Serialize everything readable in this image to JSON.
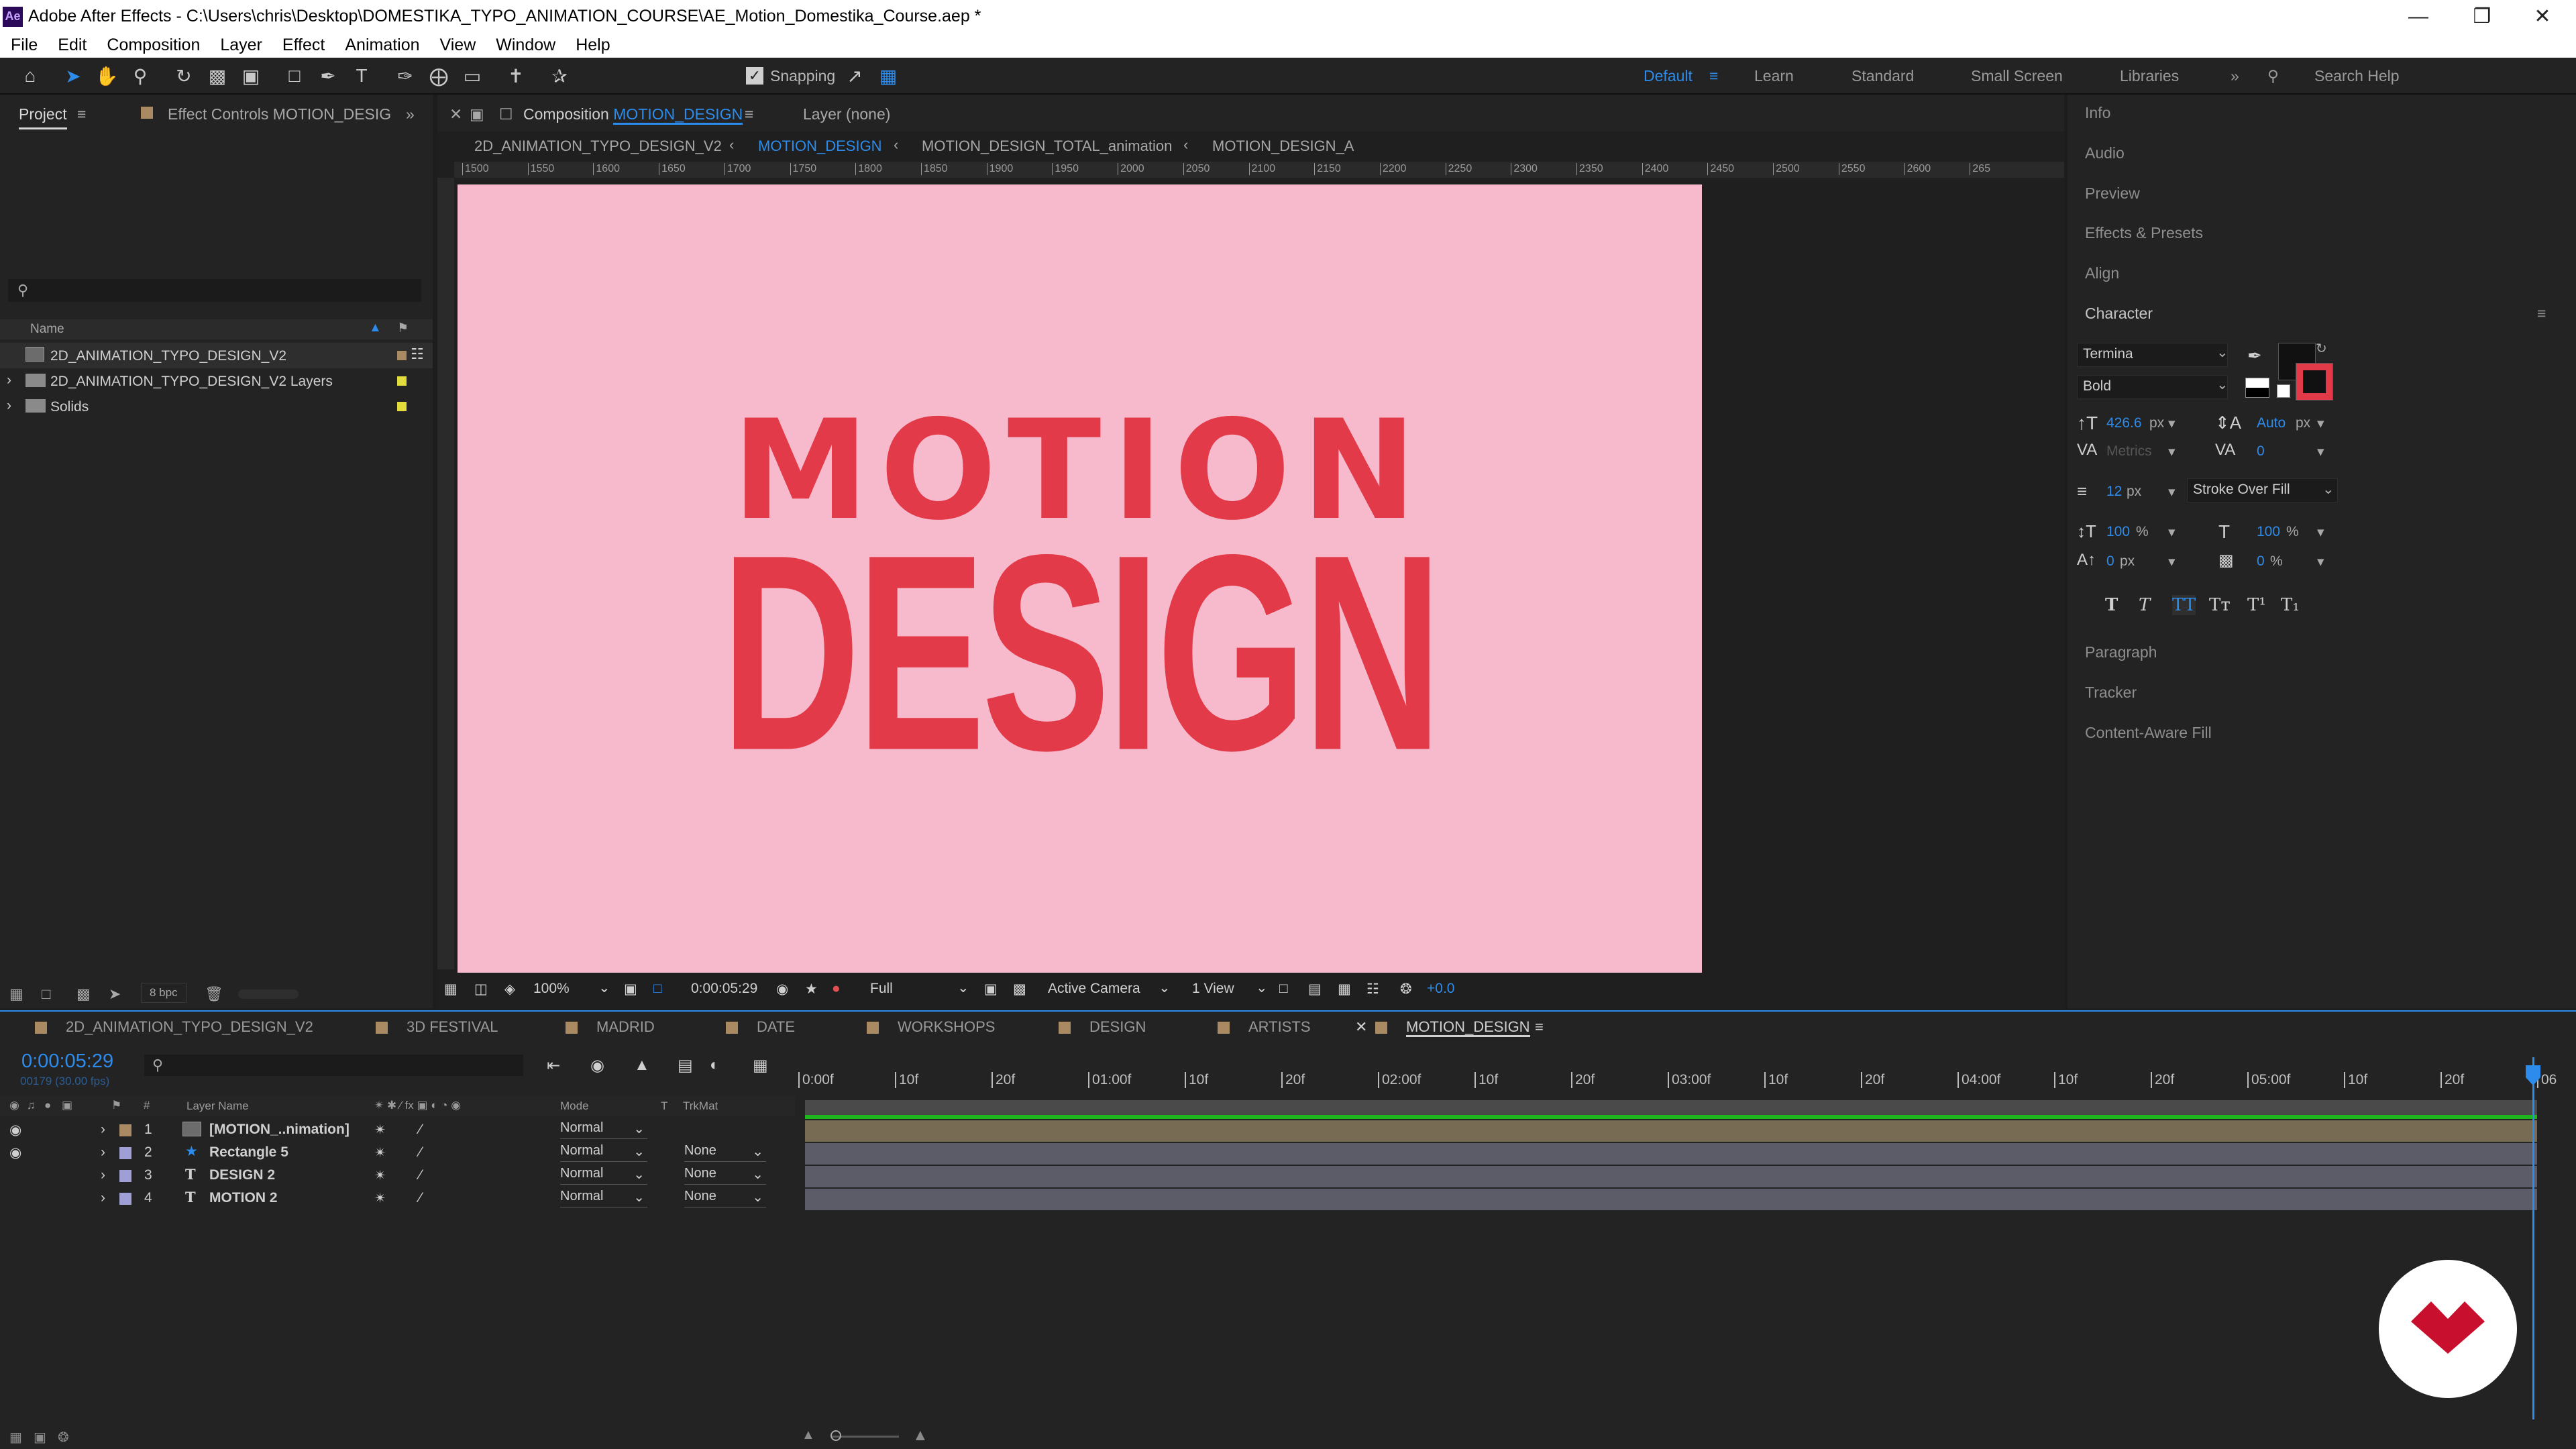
{
  "window": {
    "app": "Adobe After Effects",
    "title": "Adobe After Effects - C:\\Users\\chris\\Desktop\\DOMESTIKA_TYPO_ANIMATION_COURSE\\AE_Motion_Domestika_Course.aep *"
  },
  "menu": [
    "File",
    "Edit",
    "Composition",
    "Layer",
    "Effect",
    "Animation",
    "View",
    "Window",
    "Help"
  ],
  "toolbar": {
    "snapping": "Snapping",
    "workspaces": [
      "Default",
      "Learn",
      "Standard",
      "Small Screen",
      "Libraries"
    ],
    "search_placeholder": "Search Help"
  },
  "project": {
    "tab_project": "Project",
    "tab_effect_controls": "Effect Controls MOTION_DESIG",
    "column_name": "Name",
    "items": [
      {
        "name": "2D_ANIMATION_TYPO_DESIGN_V2",
        "label_color": "#a98a62"
      },
      {
        "name": "2D_ANIMATION_TYPO_DESIGN_V2 Layers",
        "label_color": "#e1dc3c"
      },
      {
        "name": "Solids",
        "label_color": "#e1dc3c"
      }
    ],
    "bpc": "8 bpc"
  },
  "composition": {
    "tab_prefix": "Composition",
    "tab_name": "MOTION_DESIGN",
    "layer_tab": "Layer (none)",
    "breadcrumbs": [
      "2D_ANIMATION_TYPO_DESIGN_V2",
      "MOTION_DESIGN",
      "MOTION_DESIGN_TOTAL_animation",
      "MOTION_DESIGN_A"
    ],
    "ruler_ticks": [
      "1500",
      "1550",
      "1600",
      "1650",
      "1700",
      "1750",
      "1800",
      "1850",
      "1900",
      "1950",
      "2000",
      "2050",
      "2100",
      "2150",
      "2200",
      "2250",
      "2300",
      "2350",
      "2400",
      "2450",
      "2500",
      "2550",
      "2600",
      "265"
    ],
    "canvas_text_line1": "MOTION",
    "canvas_text_line2": "DESIGN",
    "bg_color": "#f7bacd",
    "text_color": "#e23a48",
    "footer": {
      "zoom": "100%",
      "timecode": "0:00:05:29",
      "resolution": "Full",
      "camera": "Active Camera",
      "view": "1 View",
      "exposure": "+0.0"
    }
  },
  "right_panels": {
    "items_top": [
      "Info",
      "Audio",
      "Preview",
      "Effects & Presets",
      "Align"
    ],
    "character": {
      "title": "Character",
      "font": "Termina",
      "style": "Bold",
      "font_size": "426.6",
      "font_size_unit": "px",
      "leading": "Auto",
      "leading_unit": "px",
      "kerning": "Metrics",
      "tracking": "0",
      "stroke_width": "12",
      "stroke_unit": "px",
      "stroke_mode": "Stroke Over Fill",
      "vscale": "100",
      "hscale": "100",
      "pct": "%",
      "baseline": "0",
      "baseline_unit": "px",
      "tsume": "0",
      "style_buttons": [
        "T",
        "T",
        "TT",
        "Tт",
        "T¹",
        "T₁"
      ]
    },
    "items_bottom": [
      "Paragraph",
      "Tracker",
      "Content-Aware Fill"
    ]
  },
  "timeline": {
    "tabs": [
      "2D_ANIMATION_TYPO_DESIGN_V2",
      "3D FESTIVAL",
      "MADRID",
      "DATE",
      "WORKSHOPS",
      "DESIGN",
      "ARTISTS",
      "MOTION_DESIGN"
    ],
    "timecode": "0:00:05:29",
    "frame_info": "00179 (30.00 fps)",
    "col_layer_name": "Layer Name",
    "col_mode": "Mode",
    "col_t": "T",
    "col_trkmat": "TrkMat",
    "ticks": [
      "0:00f",
      "10f",
      "20f",
      "01:00f",
      "10f",
      "20f",
      "02:00f",
      "10f",
      "20f",
      "03:00f",
      "10f",
      "20f",
      "04:00f",
      "10f",
      "20f",
      "05:00f",
      "10f",
      "20f",
      "06"
    ],
    "layers": [
      {
        "num": "1",
        "name": "[MOTION_..nimation]",
        "mode": "Normal",
        "trkmat": "",
        "label_color": "#a98a62",
        "type": "comp"
      },
      {
        "num": "2",
        "name": "Rectangle 5",
        "mode": "Normal",
        "trkmat": "None",
        "label_color": "#9f9fd5",
        "type": "shape"
      },
      {
        "num": "3",
        "name": "DESIGN 2",
        "mode": "Normal",
        "trkmat": "None",
        "label_color": "#9f9fd5",
        "type": "text"
      },
      {
        "num": "4",
        "name": "MOTION 2",
        "mode": "Normal",
        "trkmat": "None",
        "label_color": "#9f9fd5",
        "type": "text"
      }
    ]
  },
  "colors": {
    "accent": "#2d8ceb",
    "panel_bg": "#232323",
    "bar_green": "#1fb51f",
    "watermark_red": "#c8102e"
  }
}
